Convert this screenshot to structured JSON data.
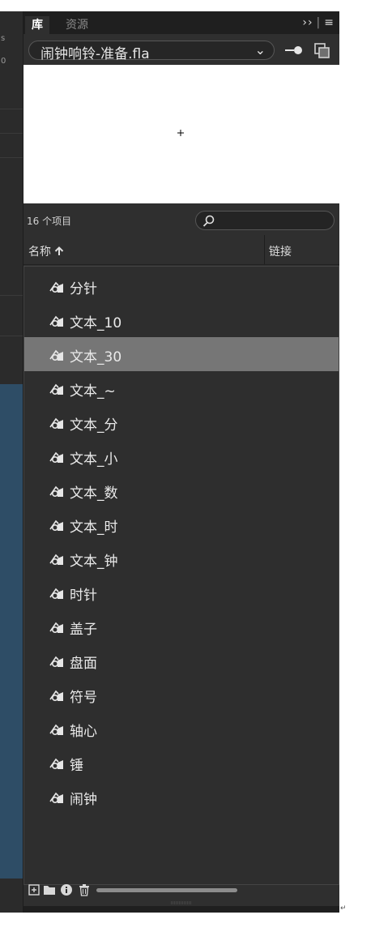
{
  "tabs": [
    {
      "label": "库"
    },
    {
      "label": "资源"
    }
  ],
  "tab_menu": {
    "expand": "››",
    "menu": "≡"
  },
  "document": {
    "name": "闹钟响铃-准备.fla"
  },
  "library": {
    "item_count": "16 个项目",
    "search_placeholder": ""
  },
  "columns": {
    "name": "名称",
    "link": "链接"
  },
  "items": [
    {
      "label": "分针",
      "selected": false
    },
    {
      "label": "文本_10",
      "selected": false
    },
    {
      "label": "文本_30",
      "selected": true
    },
    {
      "label": "文本_~",
      "selected": false
    },
    {
      "label": "文本_分",
      "selected": false
    },
    {
      "label": "文本_小",
      "selected": false
    },
    {
      "label": "文本_数",
      "selected": false
    },
    {
      "label": "文本_时",
      "selected": false
    },
    {
      "label": "文本_钟",
      "selected": false
    },
    {
      "label": "时针",
      "selected": false
    },
    {
      "label": "盖子",
      "selected": false
    },
    {
      "label": "盘面",
      "selected": false
    },
    {
      "label": "符号",
      "selected": false
    },
    {
      "label": "轴心",
      "selected": false
    },
    {
      "label": "锤",
      "selected": false
    },
    {
      "label": "闹钟",
      "selected": false
    }
  ],
  "left_sliver": {
    "char1": "s",
    "char2": "0"
  },
  "icons": {
    "item": "graphic-symbol-icon",
    "pin": "pin-icon",
    "new_library": "new-library-panel-icon",
    "search": "search-icon",
    "sort": "sort-ascending-icon",
    "new_symbol": "new-symbol-icon",
    "new_folder": "new-folder-icon",
    "properties": "properties-icon",
    "delete": "trash-icon"
  },
  "colors": {
    "panel_bg": "#2f2f2f",
    "selected_row": "#767676",
    "text": "#eaeaea"
  }
}
